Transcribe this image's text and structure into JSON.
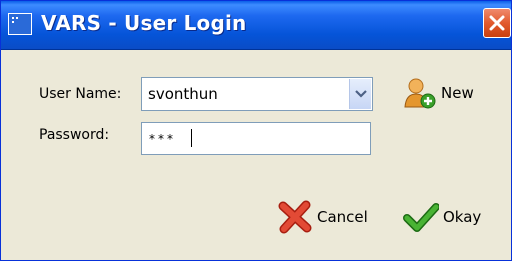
{
  "window": {
    "title": "VARS - User Login"
  },
  "form": {
    "username_label": "User Name:",
    "username_value": "svonthun",
    "password_label": "Password:",
    "password_mask": "***"
  },
  "buttons": {
    "new_label": "New",
    "cancel_label": "Cancel",
    "okay_label": "Okay"
  },
  "icons": {
    "app": "app-window-icon",
    "close": "close-icon",
    "dropdown": "chevron-down-icon",
    "new_user": "add-user-icon",
    "cancel": "red-x-icon",
    "okay": "green-check-icon"
  },
  "colors": {
    "titlebar": "#0a5fe8",
    "dialog_bg": "#ece9d8",
    "close_button": "#e25a2e",
    "okay_check": "#3aa02a",
    "cancel_x": "#d42a1a"
  }
}
